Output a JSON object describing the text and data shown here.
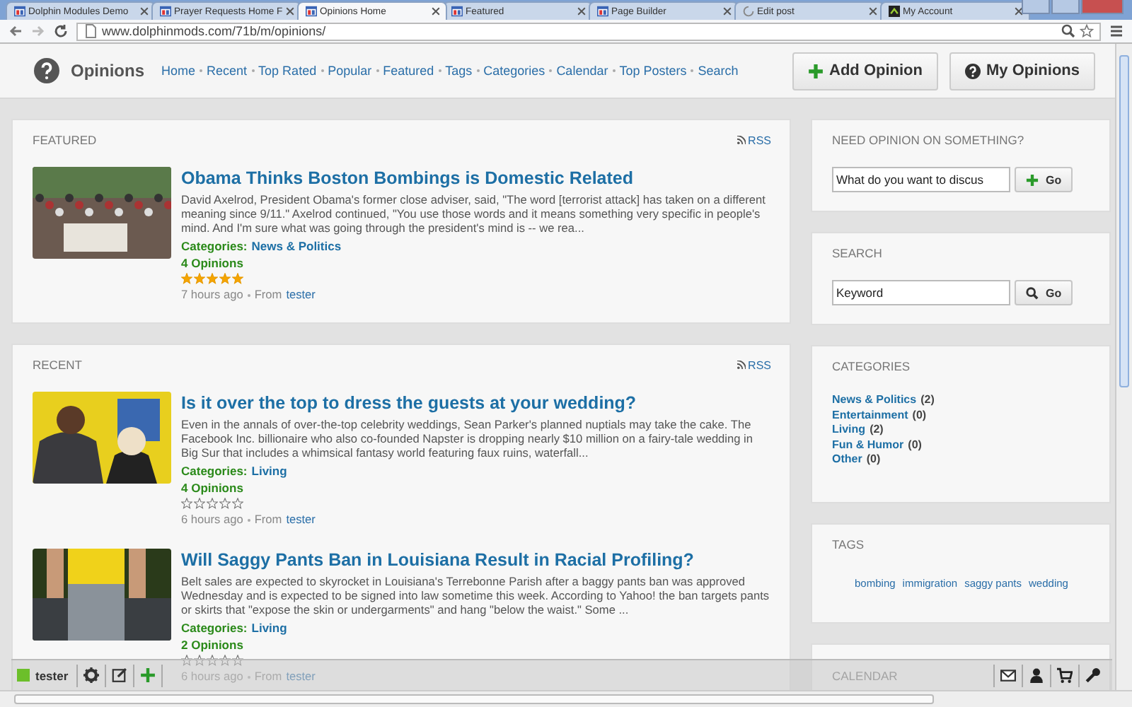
{
  "browser": {
    "tabs": [
      {
        "title": "Dolphin Modules Demo",
        "selected": false
      },
      {
        "title": "Prayer Requests Home F",
        "selected": false
      },
      {
        "title": "Opinions Home",
        "selected": true
      },
      {
        "title": "Featured",
        "selected": false
      },
      {
        "title": "Page Builder",
        "selected": false
      },
      {
        "title": "Edit post",
        "selected": false
      },
      {
        "title": "My Account",
        "selected": false
      }
    ],
    "url": "www.dolphinmods.com/71b/m/opinions/"
  },
  "header": {
    "title": "Opinions",
    "nav": [
      "Home",
      "Recent",
      "Top Rated",
      "Popular",
      "Featured",
      "Tags",
      "Categories",
      "Calendar",
      "Top Posters",
      "Search"
    ],
    "buttons": [
      "Add Opinion",
      "My Opinions"
    ]
  },
  "sections": [
    {
      "heading": "FEATURED",
      "rss": "RSS",
      "articles": [
        {
          "title": "Obama Thinks Boston Bombings is Domestic Related",
          "excerpt": "David Axelrod, President Obama's former close adviser, said, \"The word [terrorist attack] has taken on a different meaning since 9/11.\" Axelrod continued, \"You use those words and it means something very specific in people's mind. And I'm sure what was going through the president's mind is -- we rea...",
          "category_label": "Categories:",
          "category": "News & Politics",
          "opinions": "4 Opinions",
          "stars": 5,
          "time": "7 hours ago",
          "from_label": "From",
          "author": "tester"
        }
      ]
    },
    {
      "heading": "RECENT",
      "rss": "RSS",
      "articles": [
        {
          "title": "Is it over the top to dress the guests at your wedding?",
          "excerpt": "Even in the annals of over-the-top celebrity weddings, Sean Parker's planned nuptials may take the cake. The Facebook Inc. billionaire who also co-founded Napster is dropping nearly $10 million on a fairy-tale wedding in Big Sur that includes a whimsical fantasy world featuring faux ruins, waterfall...",
          "category_label": "Categories:",
          "category": "Living",
          "opinions": "4 Opinions",
          "stars": 0,
          "time": "6 hours ago",
          "from_label": "From",
          "author": "tester"
        },
        {
          "title": "Will Saggy Pants Ban in Louisiana Result in Racial Profiling?",
          "excerpt": "Belt sales are expected to skyrocket in Louisiana's Terrebonne Parish after a baggy pants ban was approved Wednesday and is expected to be signed into law sometime this week. According to Yahoo! the ban targets pants or skirts that \"expose the skin or undergarments\" and hang \"below the waist.\" Some ...",
          "category_label": "Categories:",
          "category": "Living",
          "opinions": "2 Opinions",
          "stars": 0,
          "time": "6 hours ago",
          "from_label": "From",
          "author": "tester"
        }
      ]
    }
  ],
  "sidebar": {
    "ask": {
      "heading": "NEED OPINION ON SOMETHING?",
      "value": "What do you want to discus",
      "button": "Go"
    },
    "search": {
      "heading": "SEARCH",
      "value": "Keyword",
      "button": "Go"
    },
    "categories": {
      "heading": "CATEGORIES",
      "items": [
        {
          "name": "News & Politics",
          "count": "(2)"
        },
        {
          "name": "Entertainment",
          "count": "(0)"
        },
        {
          "name": "Living",
          "count": "(2)"
        },
        {
          "name": "Fun & Humor",
          "count": "(0)"
        },
        {
          "name": "Other",
          "count": "(0)"
        }
      ]
    },
    "tags": {
      "heading": "TAGS",
      "items": [
        "bombing",
        "immigration",
        "saggy pants",
        "wedding"
      ]
    },
    "calendar": {
      "heading": "CALENDAR"
    }
  },
  "toolbar": {
    "user": "tester"
  }
}
